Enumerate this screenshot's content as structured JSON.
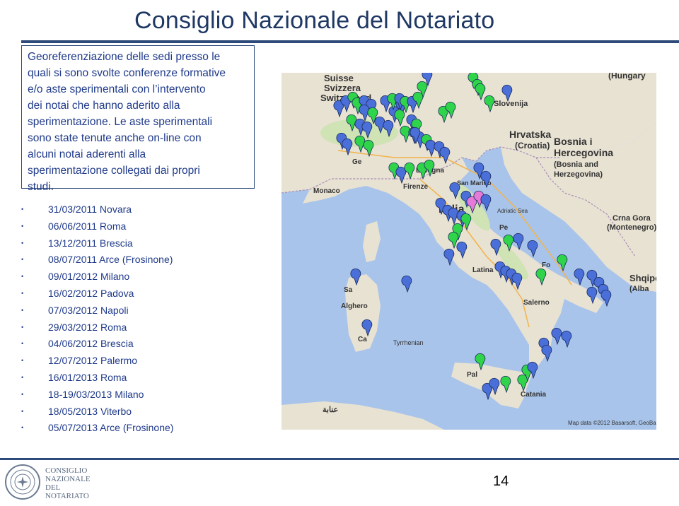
{
  "header": {
    "title": "Consiglio Nazionale del Notariato"
  },
  "callout": {
    "text_lines": [
      "Georeferenziazione delle sedi presso le",
      "quali si sono svolte conferenze formative",
      "e/o aste sperimentali con l’intervento",
      "dei notai  che hanno aderito alla",
      "sperimentazione.  Le aste sperimentali",
      "sono state tenute anche on-line con",
      "alcuni notai  aderenti alla",
      "sperimentazione collegati dai propri",
      "studi."
    ]
  },
  "events": [
    "31/03/2011 Novara",
    "06/06/2011 Roma",
    "13/12/2011 Brescia",
    "08/07/2011 Arce  (Frosinone)",
    "09/01/2012 Milano",
    "16/02/2012 Padova",
    "07/03/2012 Napoli",
    "29/03/2012 Roma",
    "04/06/2012 Brescia",
    "12/07/2012 Palermo",
    "16/01/2013 Roma",
    "18-19/03/2013 Milano",
    "18/05/2013 Viterbo",
    "05/07/2013 Arce (Frosinone)"
  ],
  "map": {
    "labels": {
      "switzerland": [
        "Suisse",
        "Svizzera",
        "Switzerland"
      ],
      "slovenia": "Slovenija",
      "hungary": "(Hungary",
      "croatia": [
        "Hrvatska",
        "(Croatia)"
      ],
      "bosnia": [
        "Bosnia i",
        "Hercegovina",
        "(Bosnia and",
        "Herzegovina)"
      ],
      "montenegro": [
        "Crna Gora",
        "(Montenegro)"
      ],
      "albania": [
        "Shqipe",
        "(Alba"
      ],
      "monaco": "Monaco",
      "genova": "Ge",
      "bologna": "Bologna",
      "firenze": "Firenze",
      "san_marino": "San Marino",
      "italia": "Italia",
      "adriatic": "Adriatic Sea",
      "pescara": "Pe",
      "latina": "Latina",
      "foggia": "Fo",
      "salerno": "Salerno",
      "sassari": "Sa",
      "alghero": "Alghero",
      "cagliari": "Ca",
      "palermo": "Pal",
      "catania": "Catania",
      "tunisia_ar": "عنابة",
      "tyrrhenian": "Tyrrhenian",
      "attribution": "Map data ©2012 Basarsoft, GeoBa"
    },
    "colors": {
      "blue_pin": "#4a6fd8",
      "green_pin": "#2fd44a",
      "pink_pin": "#e67ad8"
    }
  },
  "footer": {
    "org_name_lines": [
      "CONSIGLIO",
      "NAZIONALE",
      "DEL",
      "NOTARIATO"
    ],
    "page_number": "14"
  }
}
